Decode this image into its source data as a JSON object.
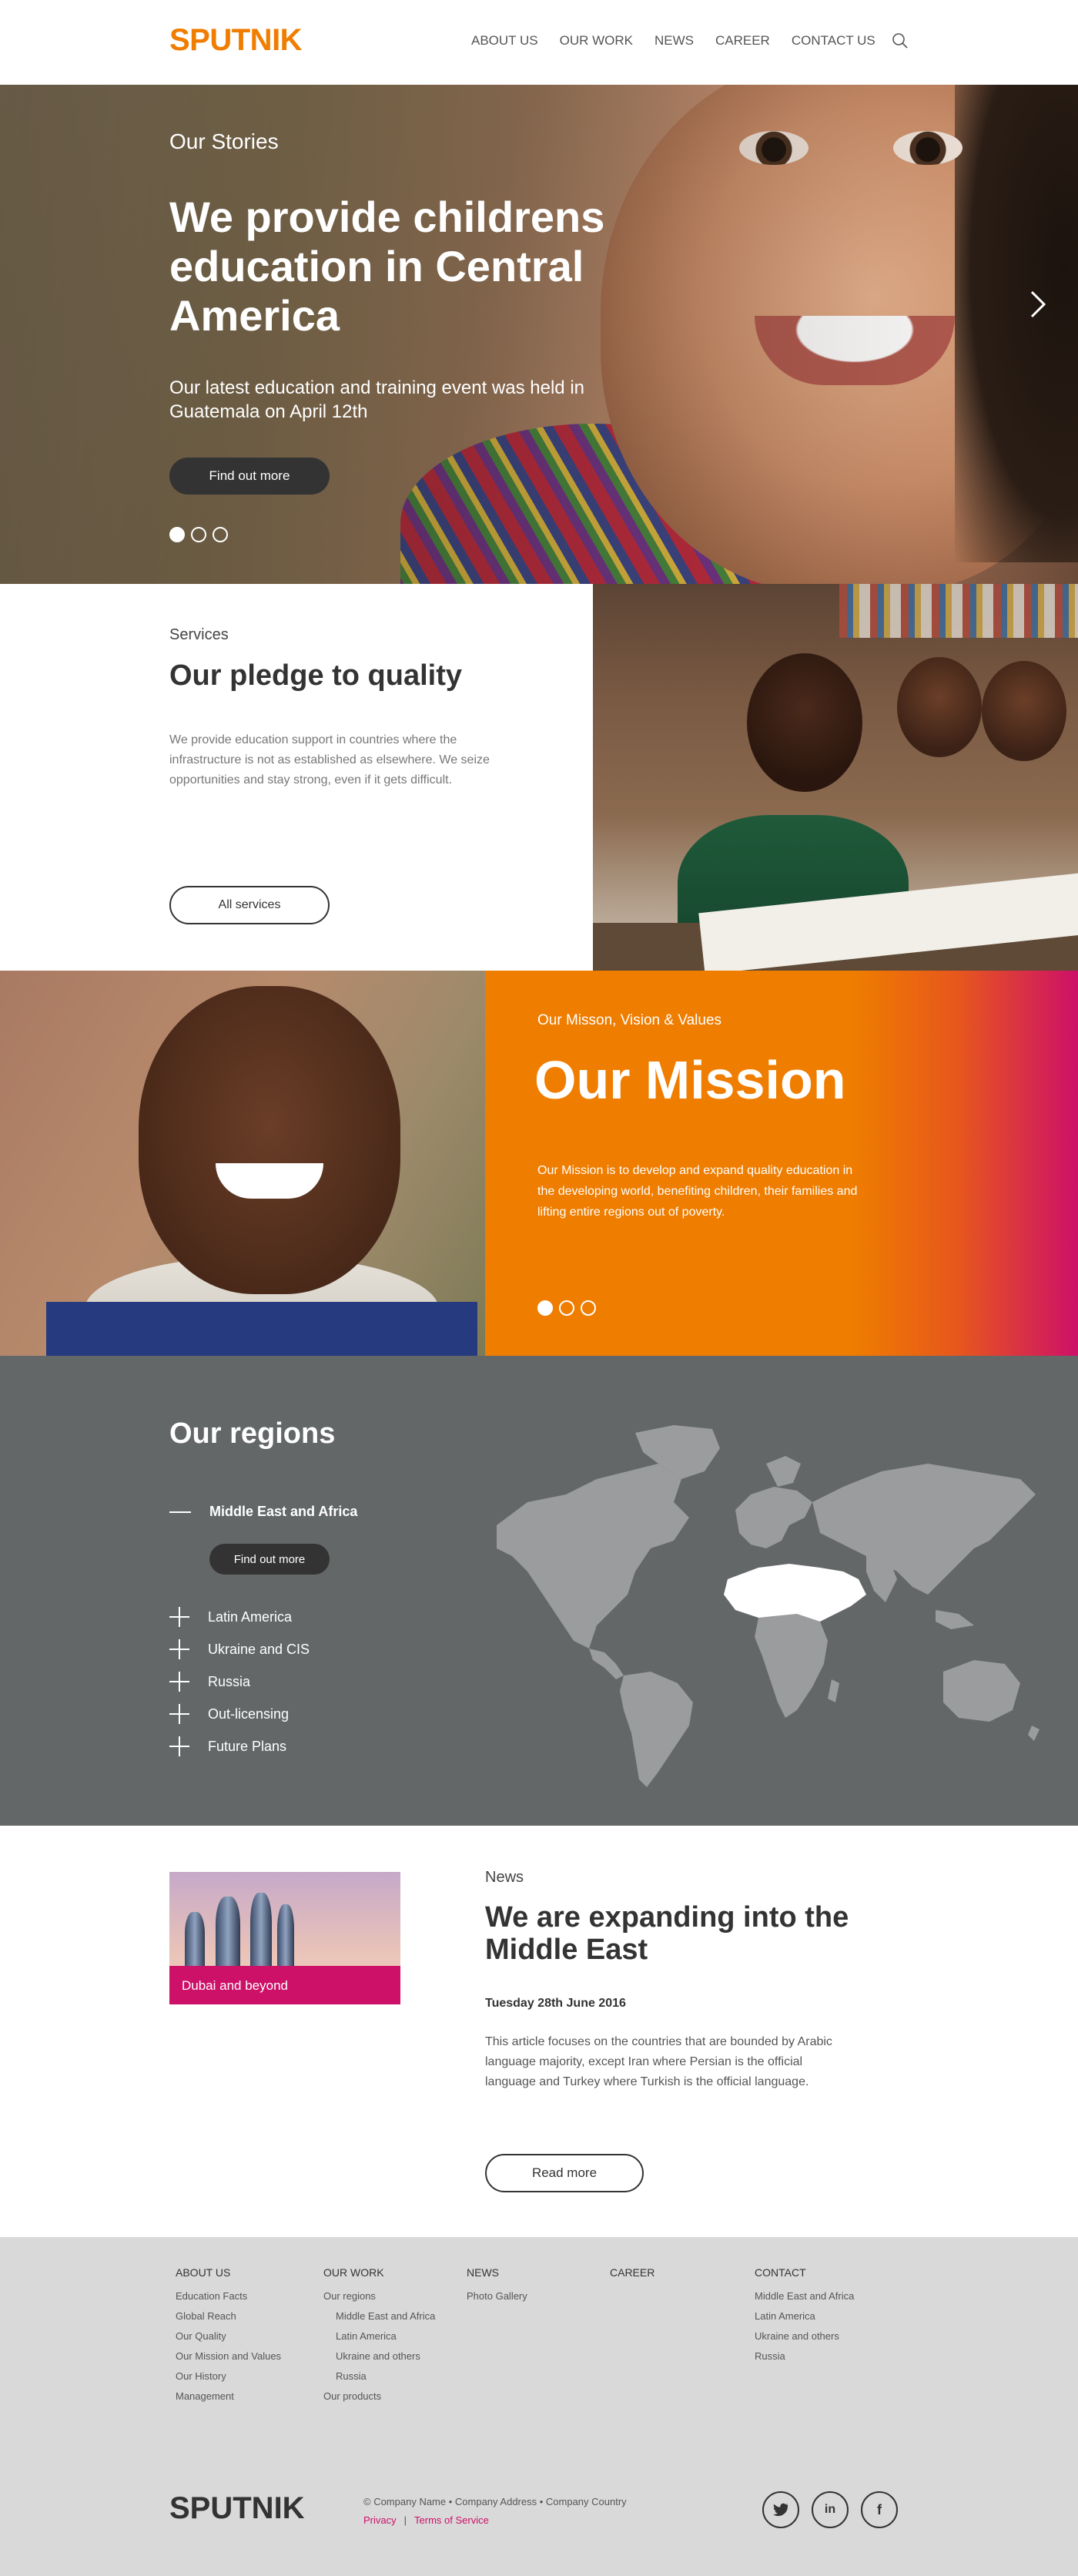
{
  "header": {
    "logo": "SPUTNIK",
    "nav": [
      "ABOUT US",
      "OUR WORK",
      "NEWS",
      "CAREER",
      "CONTACT US"
    ]
  },
  "hero": {
    "kicker": "Our Stories",
    "title": "We provide childrens education in Central America",
    "subtitle": "Our latest education and training event was held in Guatemala on April 12th",
    "button": "Find out more"
  },
  "services": {
    "kicker": "Services",
    "title": "Our pledge to quality",
    "text": "We provide education support in countries where the infrastructure is not as established as elsewhere. We seize opportunities and stay strong, even if it gets difficult.",
    "button": "All services"
  },
  "mission": {
    "kicker": "Our Misson, Vision & Values",
    "title": "Our Mission",
    "text": "Our Mission is to develop and expand quality education in the developing world, benefiting children, their families and lifting entire regions out of poverty."
  },
  "regions": {
    "title": "Our regions",
    "active": "Middle East and Africa",
    "button": "Find out more",
    "items": [
      "Latin America",
      "Ukraine and CIS",
      "Russia",
      "Out-licensing",
      "Future Plans"
    ]
  },
  "news": {
    "card_caption": "Dubai and beyond",
    "kicker": "News",
    "title": "We are expanding into the Middle East",
    "date": "Tuesday 28th June 2016",
    "text": "This article focuses on the countries that are bounded by Arabic language majority, except Iran where Persian is the official language and Turkey where Turkish is the official language.",
    "button": "Read more"
  },
  "footer": {
    "columns": [
      {
        "head": "ABOUT US",
        "links": [
          "Education Facts",
          "Global Reach",
          "Our Quality",
          "Our Mission and Values",
          "Our History",
          "Management"
        ]
      },
      {
        "head": "OUR WORK",
        "links": [
          "Our regions",
          "Middle East and Africa",
          "Latin America",
          "Ukraine and others",
          "Russia",
          "Our products"
        ]
      },
      {
        "head": "NEWS",
        "links": [
          "Photo Gallery"
        ]
      },
      {
        "head": "CAREER",
        "links": []
      },
      {
        "head": "CONTACT",
        "links": [
          "Middle East and Africa",
          "Latin America",
          "Ukraine and others",
          "Russia"
        ]
      }
    ],
    "logo": "SPUTNIK",
    "copyright": "© Company Name • Company Address • Company Country",
    "privacy": "Privacy",
    "separator": "|",
    "terms": "Terms of Service",
    "social": [
      "twitter-icon",
      "linkedin-icon",
      "facebook-icon"
    ]
  },
  "colors": {
    "brand_orange": "#f07d00",
    "magenta": "#cd1068",
    "regions_bg": "#636768",
    "footer_bg": "#d9d9d9"
  }
}
